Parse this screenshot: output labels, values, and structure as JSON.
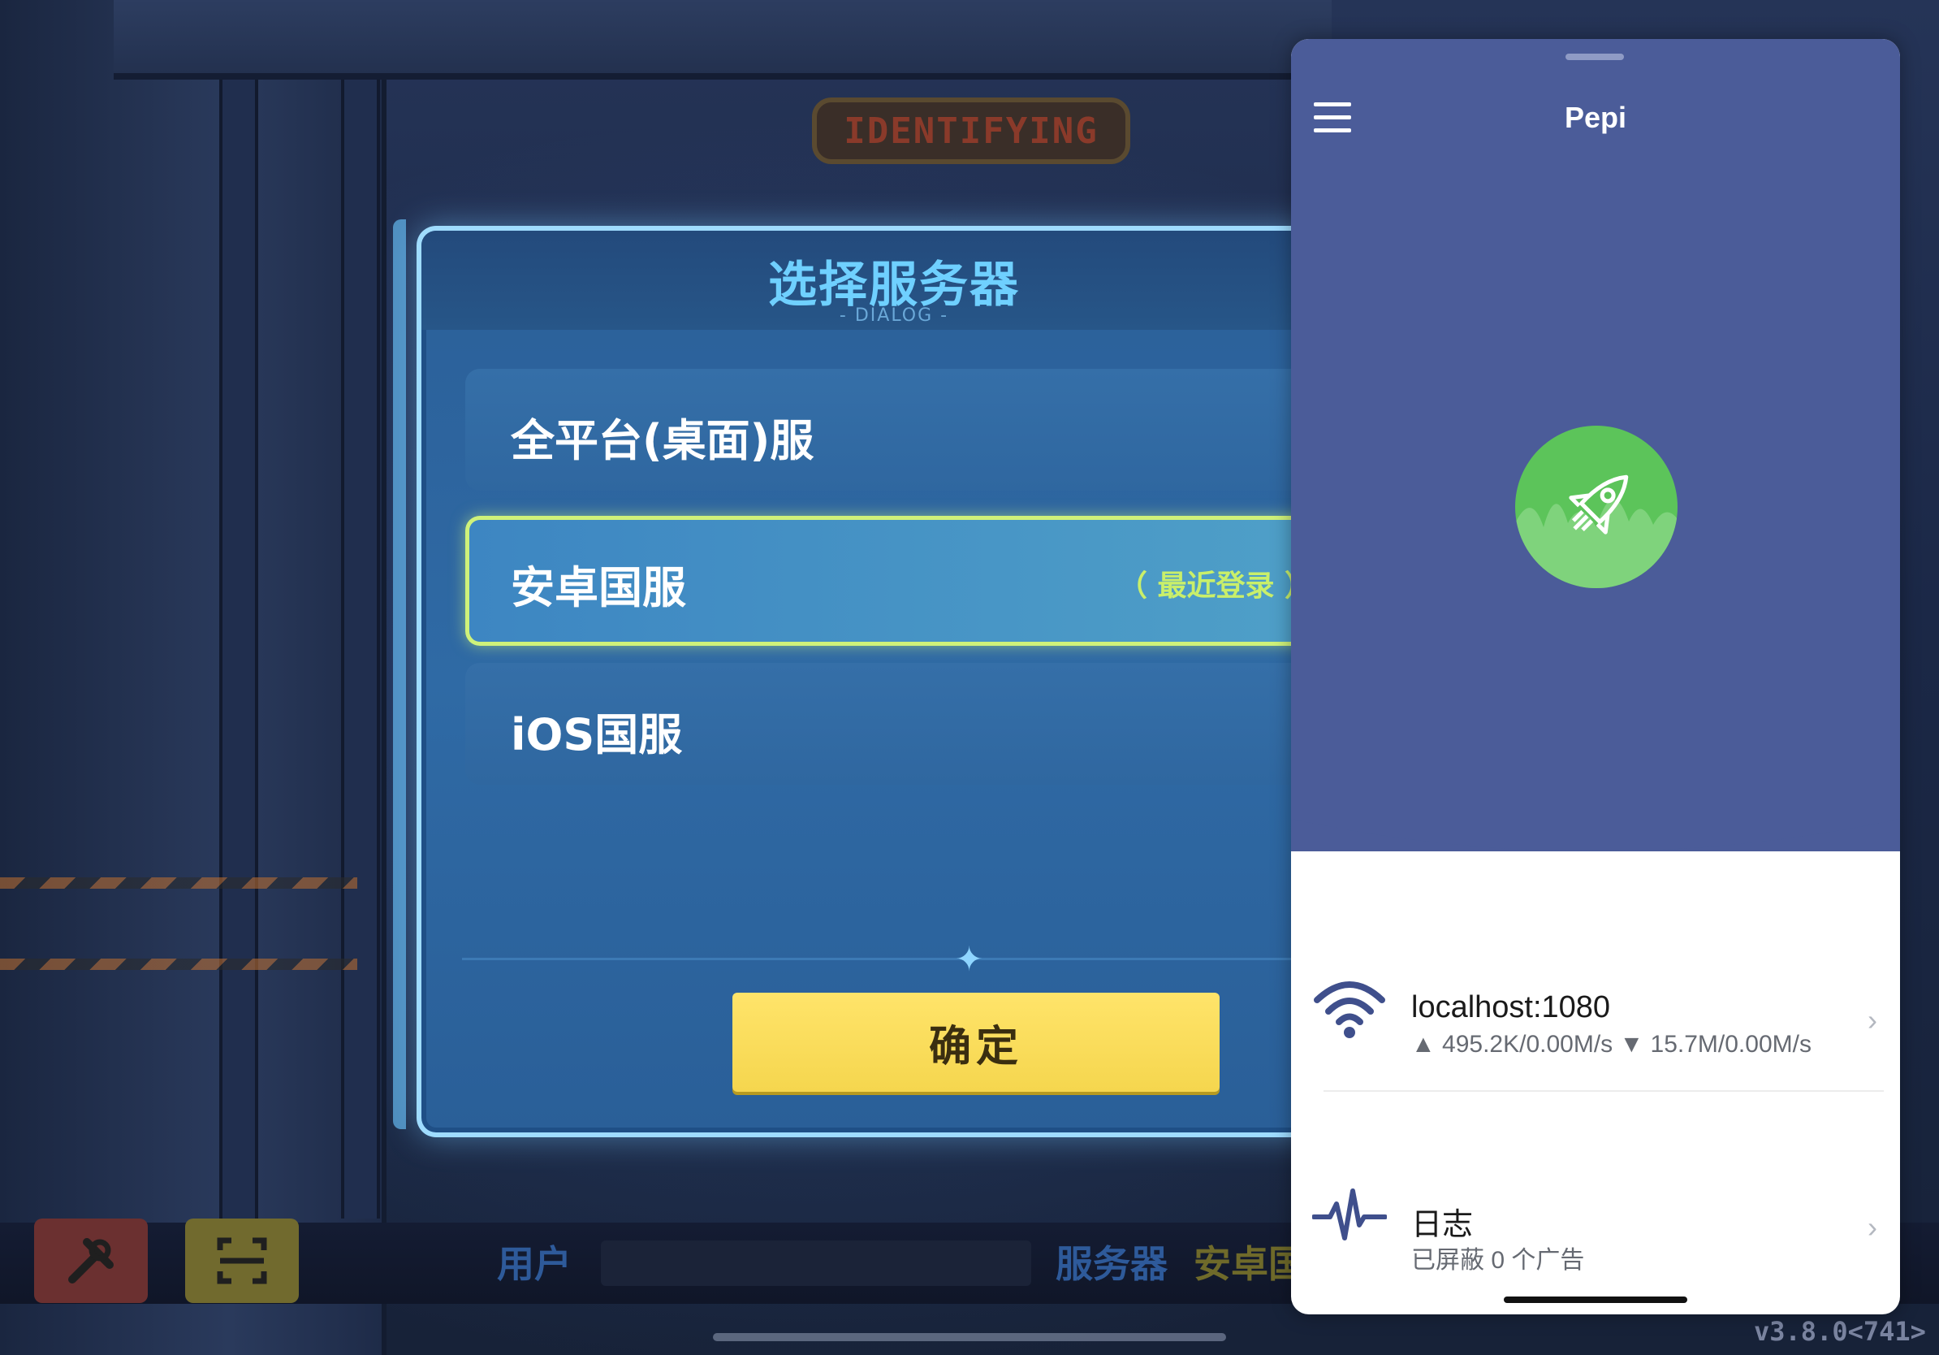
{
  "game": {
    "sign_text": "IDENTIFYING",
    "dialog": {
      "title": "选择服务器",
      "subtitle": "- DIALOG -",
      "options": [
        {
          "label": "全平台(桌面)服",
          "selected": false
        },
        {
          "label": "安卓国服",
          "selected": true,
          "tag": "（ 最近登录 ）"
        },
        {
          "label": "iOS国服",
          "selected": false
        }
      ],
      "confirm_label": "确定"
    },
    "bottom_bar": {
      "user_label": "用户",
      "server_label": "服务器",
      "server_value": "安卓国",
      "version": "v3.8.0<741>"
    },
    "colors": {
      "dialog_title": "#6fd0ff",
      "selected_border": "#cff27a",
      "confirm_bg": "#f5d64e"
    }
  },
  "pepi": {
    "title": "Pepi",
    "status": "connected",
    "colors": {
      "header": "#4b5c99",
      "power_button": "#5cc45a"
    },
    "proxy_row": {
      "icon": "wifi-icon",
      "title": "localhost:1080",
      "stats": "▲ 495.2K/0.00M/s ▼ 15.7M/0.00M/s"
    },
    "log_row": {
      "icon": "activity-icon",
      "title": "日志",
      "subtitle": "已屏蔽 0 个广告"
    }
  }
}
